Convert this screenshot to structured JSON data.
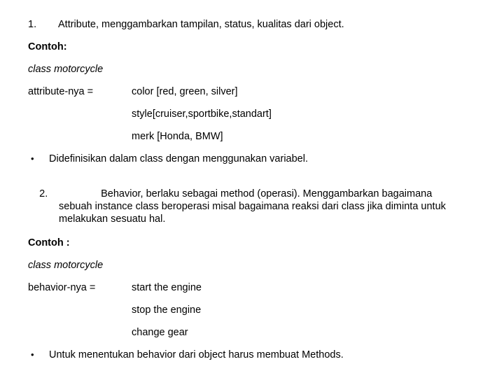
{
  "document": {
    "background_color": "#ffffff",
    "text_color": "#000000",
    "items": {
      "point1": {
        "marker": "1.",
        "text": "Attribute, menggambarkan tampilan, status, kualitas dari object."
      },
      "contoh_1_heading": "Contoh:",
      "class_decl_1": "class motorcycle",
      "attribute_label": "attribute-nya =",
      "attribute_values": [
        "color [red, green, silver]",
        "style[cruiser,sportbike,standart]",
        "merk [Honda, BMW]"
      ],
      "bullet1": {
        "marker": "•",
        "text": "Didefinisikan dalam class dengan menggunakan variabel."
      },
      "point2": {
        "marker": "2.",
        "text": "Behavior, berlaku sebagai method (operasi). Menggambarkan bagaimana sebuah instance class beroperasi misal bagaimana reaksi dari class jika diminta untuk melakukan sesuatu hal."
      },
      "contoh_2_heading": "Contoh :",
      "class_decl_2": "class motorcycle",
      "behavior_label": "behavior-nya =",
      "behavior_values": [
        "start the engine",
        "stop the engine",
        "change gear"
      ],
      "bullet2": {
        "marker": "•",
        "text": "Untuk menentukan behavior dari object harus membuat Methods."
      }
    }
  }
}
